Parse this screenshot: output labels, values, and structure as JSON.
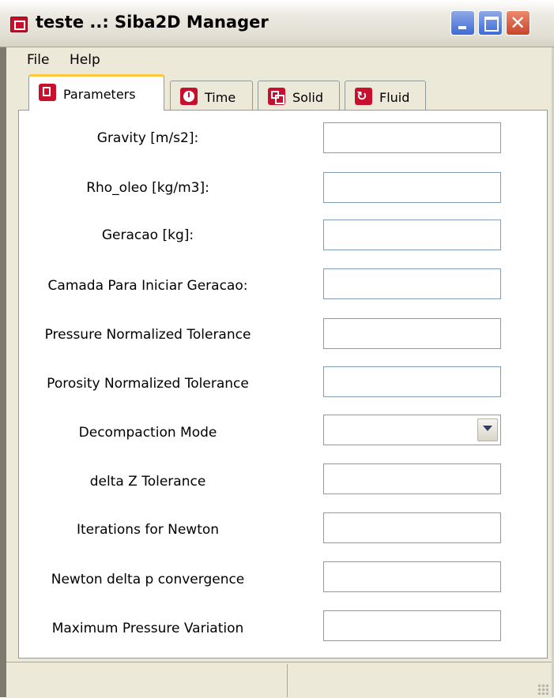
{
  "window": {
    "title": "teste ..: Siba2D Manager"
  },
  "menu": {
    "file": "File",
    "help": "Help"
  },
  "tabs": [
    {
      "label": "Parameters",
      "icon": "document-icon"
    },
    {
      "label": "Time",
      "icon": "clock-icon"
    },
    {
      "label": "Solid",
      "icon": "squares-icon"
    },
    {
      "label": "Fluid",
      "icon": "cycle-icon"
    }
  ],
  "form": {
    "gravity": {
      "label": "Gravity  [m/s2]:",
      "value": ""
    },
    "rho_oleo": {
      "label": "Rho_oleo  [kg/m3]:",
      "value": ""
    },
    "geracao": {
      "label": "Geracao  [kg]:",
      "value": ""
    },
    "camada": {
      "label": "Camada Para Iniciar Geracao:",
      "value": ""
    },
    "pressure_tol": {
      "label": "Pressure Normalized Tolerance",
      "value": ""
    },
    "porosity_tol": {
      "label": "Porosity Normalized Tolerance",
      "value": ""
    },
    "decompaction_mode": {
      "label": "Decompaction Mode",
      "value": ""
    },
    "delta_z_tol": {
      "label": "delta Z Tolerance",
      "value": ""
    },
    "iterations_newton": {
      "label": "Iterations for Newton",
      "value": ""
    },
    "newton_delta_p": {
      "label": "Newton delta p convergence",
      "value": ""
    },
    "max_pressure_var": {
      "label": "Maximum Pressure Variation",
      "value": ""
    }
  },
  "colors": {
    "accent": "#c8102e",
    "active_tab_highlight": "#ffc83c",
    "field_border": "#7f9db9"
  }
}
